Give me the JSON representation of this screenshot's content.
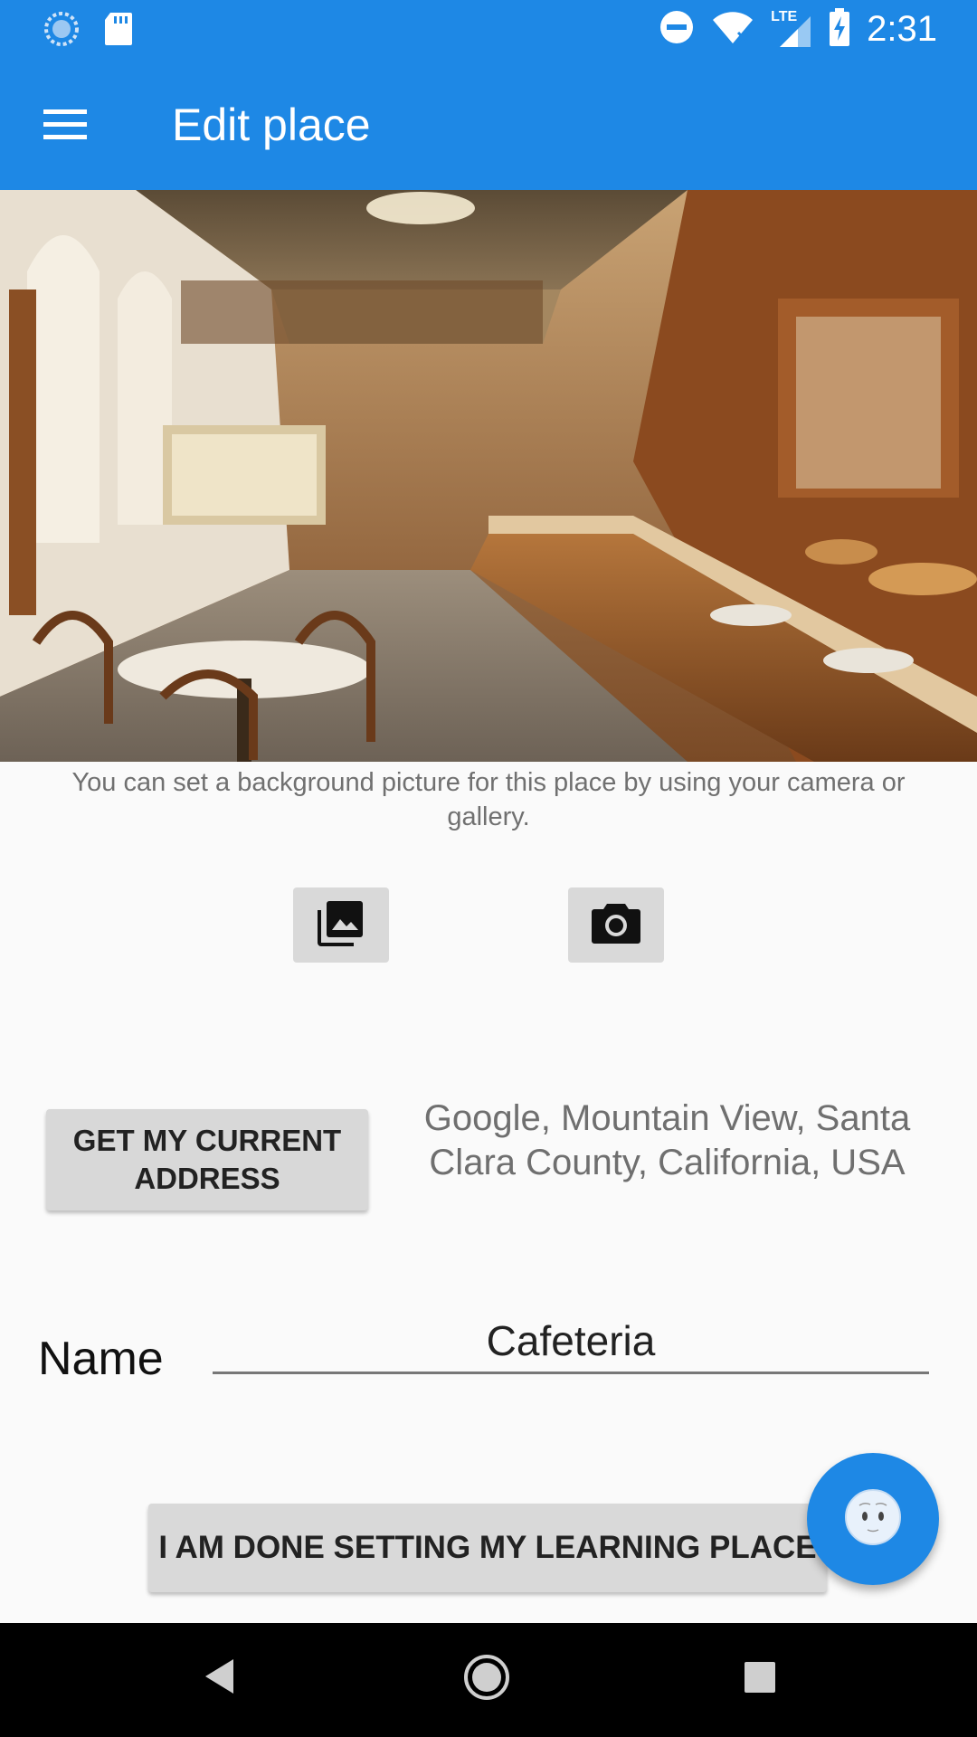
{
  "status_bar": {
    "time": "2:31",
    "network_label": "LTE",
    "icons": [
      "sync-icon",
      "sd-card-icon",
      "do-not-disturb-icon",
      "wifi-icon",
      "lte-signal-icon",
      "battery-charging-icon"
    ]
  },
  "app_bar": {
    "title": "Edit place",
    "menu_icon": "hamburger-menu-icon"
  },
  "background_picture": {
    "hint": "You can set a background picture for this place by using your camera or gallery.",
    "gallery_icon": "gallery-icon",
    "camera_icon": "camera-icon"
  },
  "address": {
    "button_label": "GET MY CURRENT ADDRESS",
    "value": "Google, Mountain View, Santa Clara County, California, USA"
  },
  "name_field": {
    "label": "Name",
    "value": "Cafeteria"
  },
  "done_button": {
    "label": "I AM DONE SETTING MY LEARNING PLACE"
  },
  "fab": {
    "icon": "robot-face-icon"
  },
  "nav_bar": {
    "icons": [
      "back-icon",
      "home-icon",
      "recents-icon"
    ]
  },
  "colors": {
    "primary": "#1e88e5",
    "background": "#fafafa",
    "button": "#d9d9d9"
  }
}
